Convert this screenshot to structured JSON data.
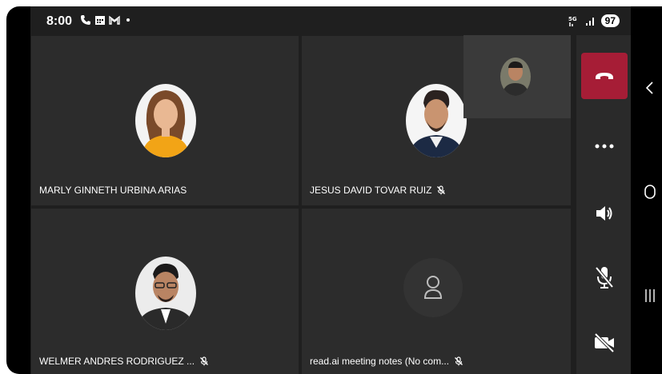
{
  "status_bar": {
    "time": "8:00",
    "battery": "97",
    "left_icons": [
      "phone-icon",
      "calendar-icon",
      "gmail-icon"
    ],
    "right_icons": [
      "5g-signal-icon",
      "signal-bars-icon"
    ]
  },
  "participants": [
    {
      "name": "MARLY GINNETH URBINA ARIAS",
      "muted": false
    },
    {
      "name": "JESUS DAVID TOVAR RUIZ",
      "muted": true
    },
    {
      "name": "WELMER ANDRES RODRIGUEZ ...",
      "muted": true
    },
    {
      "name": "read.ai meeting notes (No com...",
      "muted": true
    }
  ],
  "controls": [
    "hang-up-icon",
    "more-options-icon",
    "speaker-icon",
    "mic-off-icon",
    "video-off-icon"
  ],
  "colors": {
    "hang_up": "#a61d36",
    "tile_bg": "#2c2c2c",
    "screen_bg": "#1f1f1f"
  },
  "nav_icons": [
    "back-chevron-icon",
    "home-circle-icon",
    "recents-icon"
  ]
}
